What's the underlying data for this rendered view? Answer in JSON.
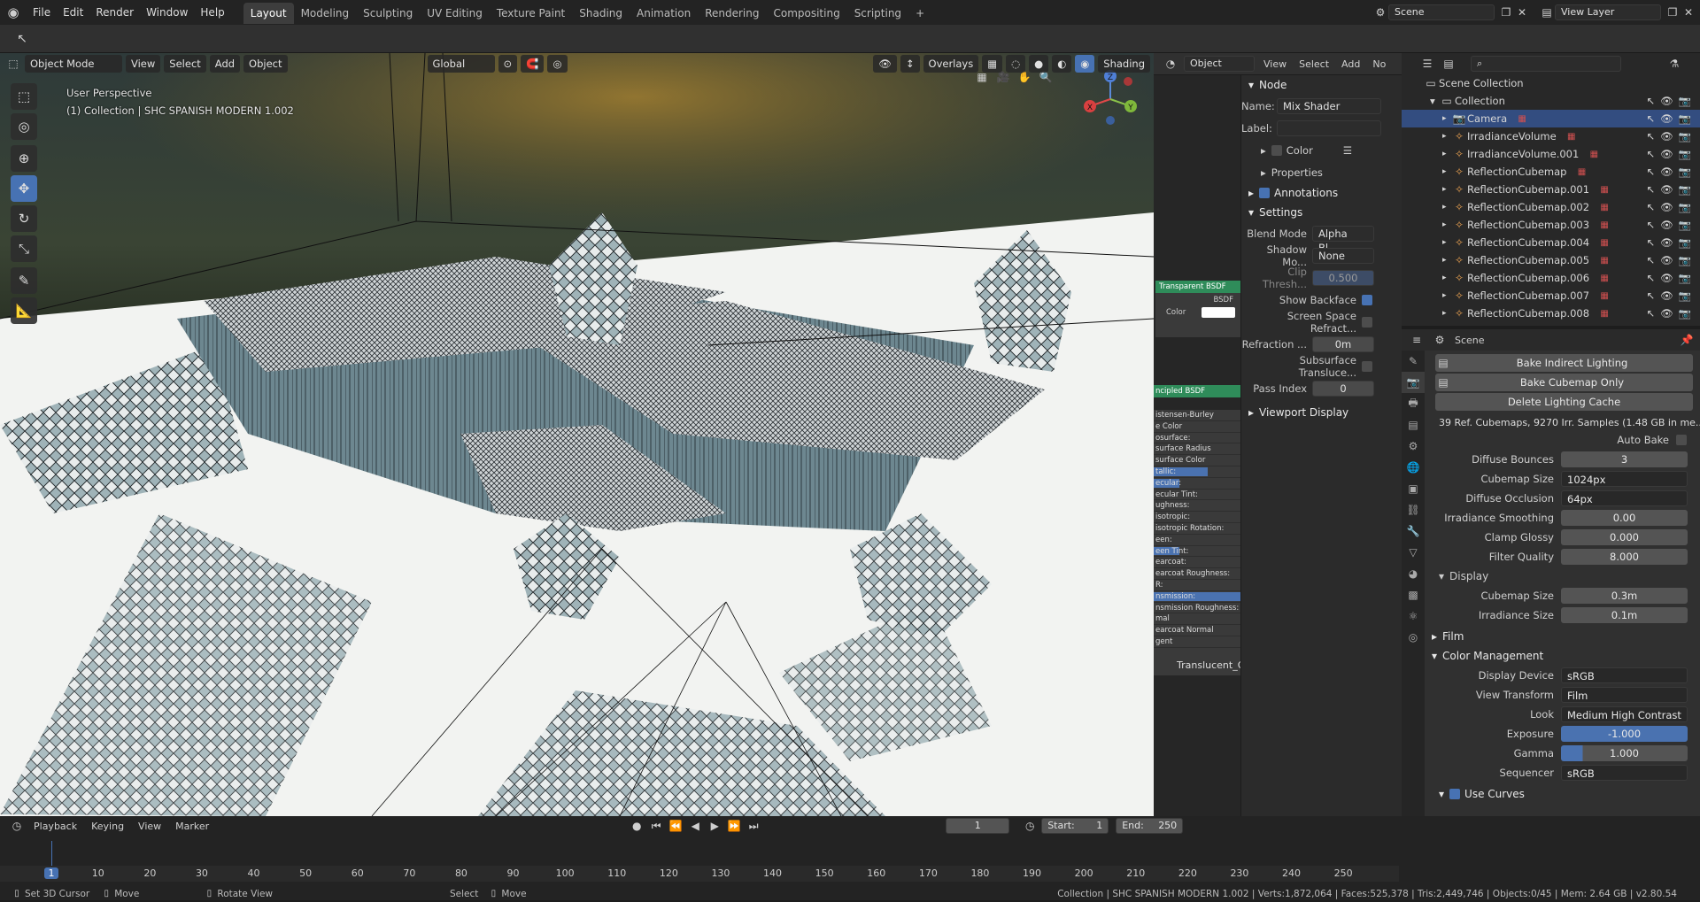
{
  "topbar": {
    "menus": [
      "File",
      "Edit",
      "Render",
      "Window",
      "Help"
    ],
    "workspaces": [
      "Layout",
      "Modeling",
      "Sculpting",
      "UV Editing",
      "Texture Paint",
      "Shading",
      "Animation",
      "Rendering",
      "Compositing",
      "Scripting"
    ],
    "active_workspace": "Layout",
    "add_tab": "+",
    "scene_label": "Scene",
    "view_layer_label": "View Layer"
  },
  "viewport": {
    "mode": "Object Mode",
    "menus": [
      "View",
      "Select",
      "Add",
      "Object"
    ],
    "orientation": "Global",
    "overlays_label": "Overlays",
    "shading_label": "Shading",
    "perspective_text": "User Perspective",
    "collection_text": "(1) Collection | SHC SPANISH MODERN 1.002",
    "gizmo": {
      "x": "X",
      "y": "Y",
      "z": "Z"
    }
  },
  "node_editor": {
    "object_label": "Object",
    "menus": [
      "View",
      "Select",
      "Add",
      "No"
    ],
    "node_section": "Node",
    "name_label": "Name:",
    "name_value": "Mix Shader",
    "label_label": "Label:",
    "label_value": "",
    "color_label": "Color",
    "properties_label": "Properties",
    "annotations_label": "Annotations",
    "settings_label": "Settings",
    "settings": [
      {
        "label": "Blend Mode",
        "value": "Alpha Bl..."
      },
      {
        "label": "Shadow Mo...",
        "value": "None"
      },
      {
        "label": "Clip Thresh...",
        "value": "0.500"
      },
      {
        "label": "Show Backface",
        "value": "checked"
      },
      {
        "label": "Screen Space Refract...",
        "value": "unchecked"
      },
      {
        "label": "Refraction ...",
        "value": "0m"
      },
      {
        "label": "Subsurface Transluce...",
        "value": "unchecked"
      },
      {
        "label": "Pass Index",
        "value": "0"
      }
    ],
    "viewport_display_label": "Viewport Display",
    "node_strip": {
      "transparent_header": "Transparent BSDF",
      "bsdf_label": "BSDF",
      "color_label": "Color",
      "principled_header": "ncipled BSDF",
      "socket_rows": [
        "istensen-Burley",
        "e Color",
        "osurface:",
        "surface Radius",
        "surface Color",
        "tallic:",
        "ecular:",
        "ecular Tint:",
        "ughness:",
        "isotropic:",
        "isotropic Rotation:",
        "een:",
        "een Tint:",
        "earcoat:",
        "earcoat Roughness:",
        "R:",
        "nsmission:",
        "nsmission Roughness:",
        "mal",
        "earcoat Normal",
        "gent"
      ],
      "translucent_label": "Translucent_G"
    }
  },
  "outliner": {
    "search_placeholder": "",
    "root": "Scene Collection",
    "collection": "Collection",
    "items": [
      "Camera",
      "IrradianceVolume",
      "IrradianceVolume.001",
      "ReflectionCubemap",
      "ReflectionCubemap.001",
      "ReflectionCubemap.002",
      "ReflectionCubemap.003",
      "ReflectionCubemap.004",
      "ReflectionCubemap.005",
      "ReflectionCubemap.006",
      "ReflectionCubemap.007",
      "ReflectionCubemap.008"
    ]
  },
  "properties": {
    "context": "Scene",
    "buttons": [
      "Bake Indirect Lighting",
      "Bake Cubemap Only",
      "Delete Lighting Cache"
    ],
    "cache_info": "39 Ref. Cubemaps, 9270 Irr. Samples (1.48 GB in me...",
    "auto_bake_label": "Auto Bake",
    "rows": [
      {
        "label": "Diffuse Bounces",
        "value": "3"
      },
      {
        "label": "Cubemap Size",
        "value": "1024px"
      },
      {
        "label": "Diffuse Occlusion",
        "value": "64px"
      },
      {
        "label": "Irradiance Smoothing",
        "value": "0.00"
      },
      {
        "label": "Clamp Glossy",
        "value": "0.000"
      },
      {
        "label": "Filter Quality",
        "value": "8.000"
      }
    ],
    "display_label": "Display",
    "display_rows": [
      {
        "label": "Cubemap Size",
        "value": "0.3m"
      },
      {
        "label": "Irradiance Size",
        "value": "0.1m"
      }
    ],
    "film_label": "Film",
    "color_mgmt_label": "Color Management",
    "cm_rows": [
      {
        "label": "Display Device",
        "value": "sRGB"
      },
      {
        "label": "View Transform",
        "value": "Film"
      },
      {
        "label": "Look",
        "value": "Medium High Contrast"
      },
      {
        "label": "Exposure",
        "value": "-1.000"
      },
      {
        "label": "Gamma",
        "value": "1.000"
      },
      {
        "label": "Sequencer",
        "value": "sRGB"
      }
    ],
    "use_curves_label": "Use Curves"
  },
  "timeline": {
    "menus": [
      "Playback",
      "Keying",
      "View",
      "Marker"
    ],
    "current_frame": "1",
    "start_label": "Start:",
    "start_value": "1",
    "end_label": "End:",
    "end_value": "250",
    "ticks": [
      "1",
      "10",
      "20",
      "30",
      "40",
      "50",
      "60",
      "70",
      "80",
      "90",
      "100",
      "110",
      "120",
      "130",
      "140",
      "150",
      "160",
      "170",
      "180",
      "190",
      "200",
      "210",
      "220",
      "230",
      "240",
      "250"
    ]
  },
  "status": {
    "hints": [
      "Set 3D Cursor",
      "Move",
      "Rotate View",
      "Select",
      "Move"
    ],
    "info": "Collection | SHC SPANISH MODERN 1.002 | Verts:1,872,064 | Faces:525,378 | Tris:2,449,746 | Objects:0/45 | Mem: 2.64 GB | v2.80.54"
  }
}
